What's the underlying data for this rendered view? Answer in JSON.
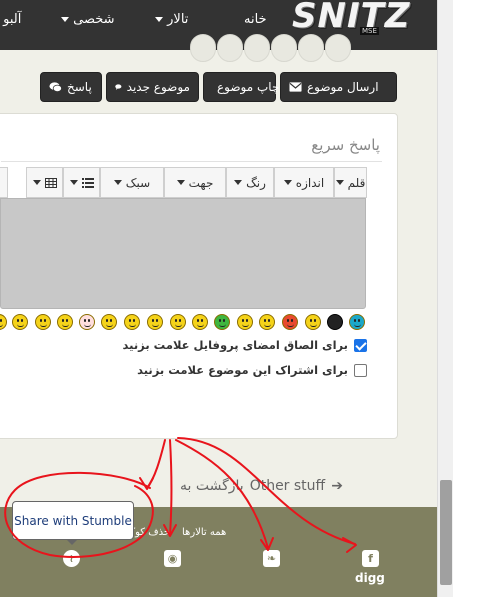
{
  "navbar": {
    "home": "خانه",
    "forums": "تالار",
    "personal": "شخصی",
    "album": "آلبو",
    "logo_text": "SNITZ",
    "logo_sub": "MSE"
  },
  "actions": {
    "send_topic": "ارسال موضوع",
    "print_topic": "چاپ موضوع",
    "new_topic": "موضوع جدید",
    "reply": "پاسخ"
  },
  "quick_reply": {
    "title": "پاسخ سریع",
    "toolbar": [
      "قلم",
      "اندازه",
      "رنگ",
      "جهت",
      "سبک"
    ],
    "signature_label": "برای الصاق امضای پروفایل علامت بزنید",
    "signature_checked": true,
    "subscribe_label": "برای اشتراک این موضوع علامت بزنید",
    "subscribe_checked": false
  },
  "back_link": {
    "prefix": "بازگشت به",
    "target": "Other stuff"
  },
  "footer": {
    "all_forums": "همه تالارها",
    "delete_cookie": "حذف کوکی",
    "digg": "digg"
  },
  "tooltip": {
    "text": "Share with Stumble"
  },
  "colors": {
    "navbar": "#333333",
    "footer": "#808060",
    "annotation": "#e8141c",
    "page_bg": "#f0f0e8"
  }
}
